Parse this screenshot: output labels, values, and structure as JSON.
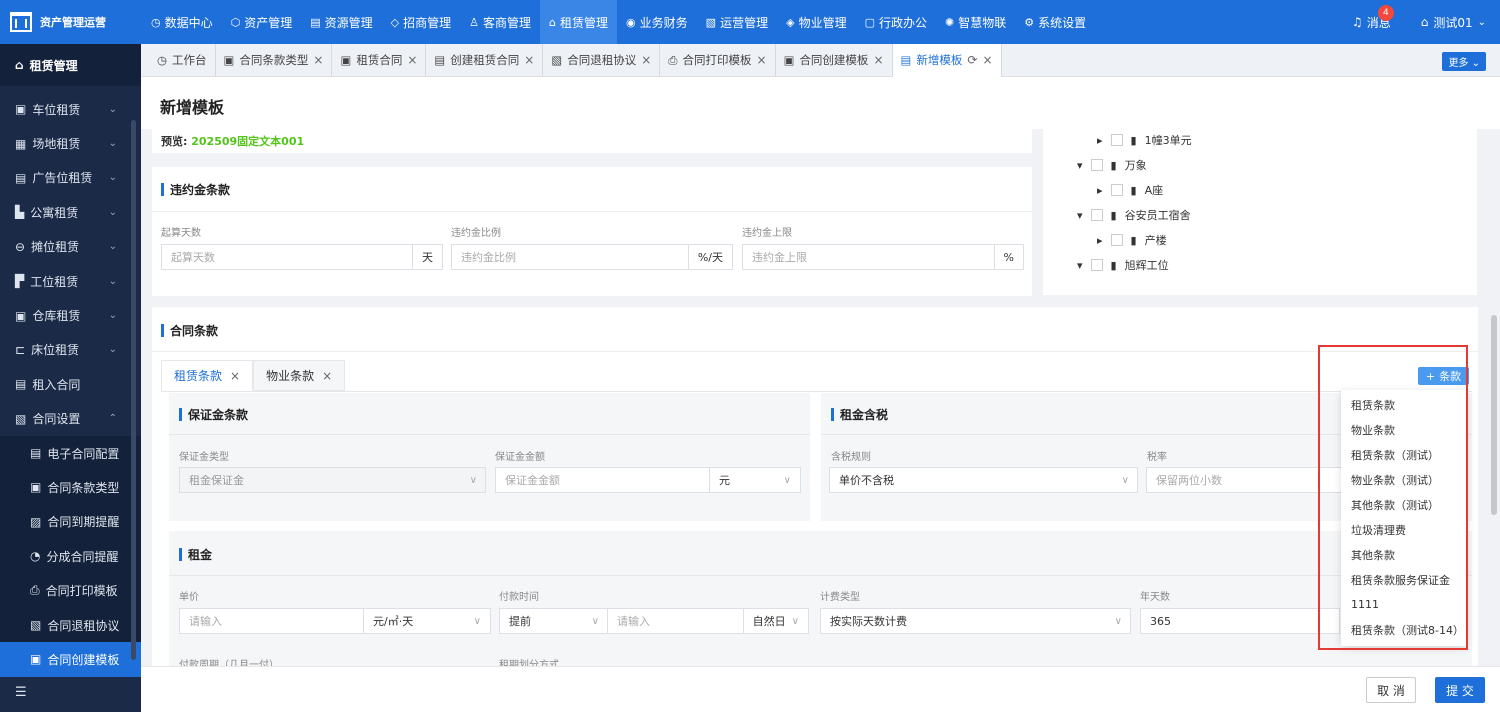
{
  "app": {
    "title": "资产管理运营"
  },
  "nav": {
    "items": [
      {
        "label": "数据中心",
        "icon": "clock-icon",
        "glyph": "◷"
      },
      {
        "label": "资产管理",
        "icon": "cube-icon",
        "glyph": "⬡"
      },
      {
        "label": "资源管理",
        "icon": "building-icon",
        "glyph": "▤"
      },
      {
        "label": "招商管理",
        "icon": "tag-icon",
        "glyph": "◇"
      },
      {
        "label": "客商管理",
        "icon": "user-icon",
        "glyph": "♙"
      },
      {
        "label": "租赁管理",
        "icon": "home-icon",
        "glyph": "⌂"
      },
      {
        "label": "业务财务",
        "icon": "money-icon",
        "glyph": "◉"
      },
      {
        "label": "运营管理",
        "icon": "chart-icon",
        "glyph": "▧"
      },
      {
        "label": "物业管理",
        "icon": "tools-icon",
        "glyph": "◈"
      },
      {
        "label": "行政办公",
        "icon": "desk-icon",
        "glyph": "▢"
      },
      {
        "label": "智慧物联",
        "icon": "iot-icon",
        "glyph": "✺"
      },
      {
        "label": "系统设置",
        "icon": "gear-icon",
        "glyph": "⚙"
      }
    ],
    "active": "租赁管理"
  },
  "header": {
    "messages_label": "消息",
    "messages_count": "4",
    "user": "测试01"
  },
  "sidebar": {
    "title": "租赁管理",
    "items": [
      {
        "label": "车位租赁",
        "icon": "parking-icon",
        "glyph": "▣",
        "chevron": "⌄"
      },
      {
        "label": "场地租赁",
        "icon": "field-icon",
        "glyph": "▦",
        "chevron": "⌄"
      },
      {
        "label": "广告位租赁",
        "icon": "ad-icon",
        "glyph": "▤",
        "chevron": "⌄"
      },
      {
        "label": "公寓租赁",
        "icon": "apartment-icon",
        "glyph": "▙",
        "chevron": "⌄"
      },
      {
        "label": "摊位租赁",
        "icon": "stall-icon",
        "glyph": "⊖",
        "chevron": "⌄"
      },
      {
        "label": "工位租赁",
        "icon": "workstation-icon",
        "glyph": "▛",
        "chevron": "⌄"
      },
      {
        "label": "仓库租赁",
        "icon": "warehouse-icon",
        "glyph": "▣",
        "chevron": "⌄"
      },
      {
        "label": "床位租赁",
        "icon": "bed-icon",
        "glyph": "⊏",
        "chevron": "⌄"
      },
      {
        "label": "租入合同",
        "icon": "contract-in-icon",
        "glyph": "▤",
        "chevron": ""
      },
      {
        "label": "合同设置",
        "icon": "contract-settings-icon",
        "glyph": "▧",
        "chevron": "⌃"
      }
    ],
    "sub_items": [
      {
        "label": "电子合同配置",
        "icon": "e-contract-icon",
        "glyph": "▤"
      },
      {
        "label": "合同条款类型",
        "icon": "clause-type-icon",
        "glyph": "▣"
      },
      {
        "label": "合同到期提醒",
        "icon": "expiry-icon",
        "glyph": "▨"
      },
      {
        "label": "分成合同提醒",
        "icon": "pie-icon",
        "glyph": "◔"
      },
      {
        "label": "合同打印模板",
        "icon": "print-icon",
        "glyph": "⎙"
      },
      {
        "label": "合同退租协议",
        "icon": "terminate-icon",
        "glyph": "▧"
      },
      {
        "label": "合同创建模板",
        "icon": "template-icon",
        "glyph": "▣"
      }
    ],
    "foot_glyph": "☰"
  },
  "tabs": {
    "items": [
      {
        "label": "工作台",
        "icon": "dashboard-icon",
        "glyph": "◷",
        "closable": false
      },
      {
        "label": "合同条款类型",
        "icon": "doc-icon",
        "glyph": "▣",
        "closable": true
      },
      {
        "label": "租赁合同",
        "icon": "doc-icon",
        "glyph": "▣",
        "closable": true
      },
      {
        "label": "创建租赁合同",
        "icon": "doc-icon",
        "glyph": "▤",
        "closable": true
      },
      {
        "label": "合同退租协议",
        "icon": "doc-icon",
        "glyph": "▧",
        "closable": true
      },
      {
        "label": "合同打印模板",
        "icon": "print-icon",
        "glyph": "⎙",
        "closable": true
      },
      {
        "label": "合同创建模板",
        "icon": "doc-icon",
        "glyph": "▣",
        "closable": true
      },
      {
        "label": "新增模板",
        "icon": "doc-icon",
        "glyph": "▤",
        "closable": true
      }
    ],
    "refresh_glyph": "⟳",
    "close_glyph": "×",
    "more_label": "更多"
  },
  "page": {
    "title": "新增模板",
    "preview_label": "预览:",
    "preview_value": "202509固定文本001"
  },
  "penalty": {
    "title": "违约金条款",
    "fields": [
      {
        "label": "起算天数",
        "placeholder": "起算天数",
        "suffix": "天"
      },
      {
        "label": "违约金比例",
        "placeholder": "违约金比例",
        "suffix": "%/天"
      },
      {
        "label": "违约金上限",
        "placeholder": "违约金上限",
        "suffix": "%"
      }
    ]
  },
  "tree": {
    "nodes": [
      {
        "label": "1幢3单元",
        "arrow": "▸"
      },
      {
        "label": "万象",
        "arrow": "▾"
      },
      {
        "label": "A座",
        "arrow": "▸"
      },
      {
        "label": "谷安员工宿舍",
        "arrow": "▾"
      },
      {
        "label": "产楼",
        "arrow": "▸"
      },
      {
        "label": "旭辉工位",
        "arrow": "▾"
      }
    ]
  },
  "clauses": {
    "title": "合同条款",
    "tabs": [
      "租赁条款",
      "物业条款"
    ],
    "add_label": "条款",
    "deposit": {
      "title": "保证金条款",
      "type_label": "保证金类型",
      "type_value": "租金保证金",
      "amount_label": "保证金金额",
      "amount_placeholder": "保证金金额",
      "unit_value": "元"
    },
    "tax": {
      "title": "租金含税",
      "rule_label": "含税规则",
      "rule_value": "单价不含税",
      "rate_label": "税率",
      "rate_placeholder": "保留两位小数"
    },
    "rent": {
      "title": "租金",
      "price_label": "单价",
      "price_placeholder": "请输入",
      "price_unit": "元/㎡·天",
      "pay_label": "付款时间",
      "pay_mode": "提前",
      "pay_placeholder": "请输入",
      "pay_unit": "自然日",
      "calc_label": "计费类型",
      "calc_value": "按实际天数计费",
      "days_label": "年天数",
      "days_value": "365",
      "cycle_label": "付款周期（几月一付）",
      "split_label": "租期划分方式"
    }
  },
  "dropdown": {
    "items": [
      "租赁条款",
      "物业条款",
      "租赁条款（测试）",
      "物业条款（测试）",
      "其他条款（测试）",
      "垃圾清理费",
      "其他条款",
      "租赁条款服务保证金",
      "1111",
      "租赁条款（测试8-14）"
    ]
  },
  "footer": {
    "cancel_label": "取 消",
    "submit_label": "提 交"
  }
}
